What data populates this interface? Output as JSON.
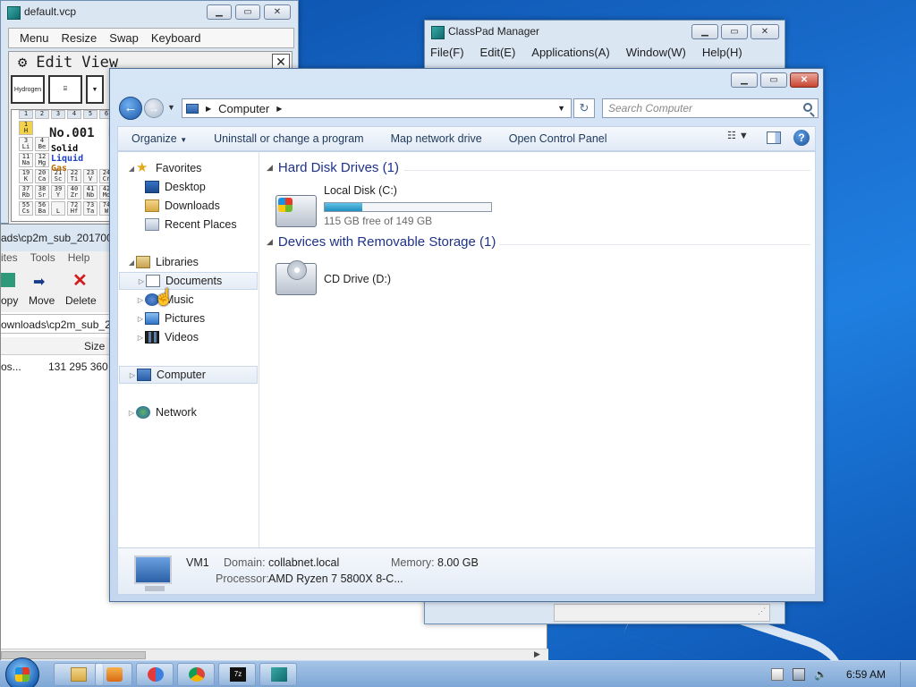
{
  "vcp": {
    "title": "default.vcp",
    "menu": [
      "Menu",
      "Resize",
      "Swap",
      "Keyboard"
    ],
    "edit_bar": [
      "Edit",
      "View"
    ],
    "gear": "⚙",
    "close": "✕",
    "tool_hydrogen": "Hydrogen",
    "element_number": "No.001",
    "element_symbol": "H",
    "col_headers": [
      "1",
      "2",
      "3",
      "4",
      "5",
      "6"
    ],
    "states": {
      "solid": "Solid",
      "liquid": "Liquid",
      "gas": "Gas"
    },
    "cells": [
      [
        "H",
        ""
      ],
      [
        "Li",
        "Be"
      ],
      [
        "Na",
        "Mg"
      ],
      [
        "K",
        "Ca",
        "Sc",
        "Ti",
        "V",
        "Cr"
      ],
      [
        "Rb",
        "Sr",
        "Y",
        "Zr",
        "Nb",
        "Mo"
      ],
      [
        "Cs",
        "Ba",
        "L",
        "Hf",
        "Ta",
        "W"
      ]
    ],
    "atomic_numbers": [
      [
        "1",
        ""
      ],
      [
        "3",
        "4"
      ],
      [
        "11",
        "12"
      ],
      [
        "19",
        "20",
        "21",
        "22",
        "23",
        "24"
      ],
      [
        "37",
        "38",
        "39",
        "40",
        "41",
        "42"
      ],
      [
        "55",
        "56",
        "",
        "72",
        "73",
        "74"
      ]
    ]
  },
  "filemanager": {
    "title": "ads\\cp2m_sub_2017000",
    "menu": [
      "ites",
      "Tools",
      "Help"
    ],
    "toolbar": [
      "opy",
      "Move",
      "Delete"
    ],
    "path": "ownloads\\cp2m_sub_2",
    "header_size": "Size",
    "row": {
      "name": "os...",
      "size": "131 295 360"
    }
  },
  "classpad": {
    "title": "ClassPad Manager",
    "menu": [
      "File(F)",
      "Edit(E)",
      "Applications(A)",
      "Window(W)",
      "Help(H)"
    ]
  },
  "explorer": {
    "address": "Computer",
    "search_placeholder": "Search Computer",
    "commands": [
      "Organize",
      "Uninstall or change a program",
      "Map network drive",
      "Open Control Panel"
    ],
    "nav": {
      "favorites": "Favorites",
      "desktop": "Desktop",
      "downloads": "Downloads",
      "recent": "Recent Places",
      "libraries": "Libraries",
      "documents": "Documents",
      "music": "Music",
      "pictures": "Pictures",
      "videos": "Videos",
      "computer": "Computer",
      "network": "Network"
    },
    "groups": {
      "hdd": "Hard Disk Drives (1)",
      "removable": "Devices with Removable Storage (1)"
    },
    "drives": {
      "c_name": "Local Disk (C:)",
      "c_free": "115 GB free of 149 GB",
      "c_used_fraction": 0.228,
      "d_name": "CD Drive (D:)"
    },
    "details": {
      "name": "VM1",
      "domain_label": "Domain:",
      "domain": "collabnet.local",
      "memory_label": "Memory:",
      "memory": "8.00 GB",
      "processor_label": "Processor:",
      "processor": "AMD Ryzen 7 5800X 8-C..."
    }
  },
  "taskbar": {
    "clock": "6:59 AM"
  }
}
